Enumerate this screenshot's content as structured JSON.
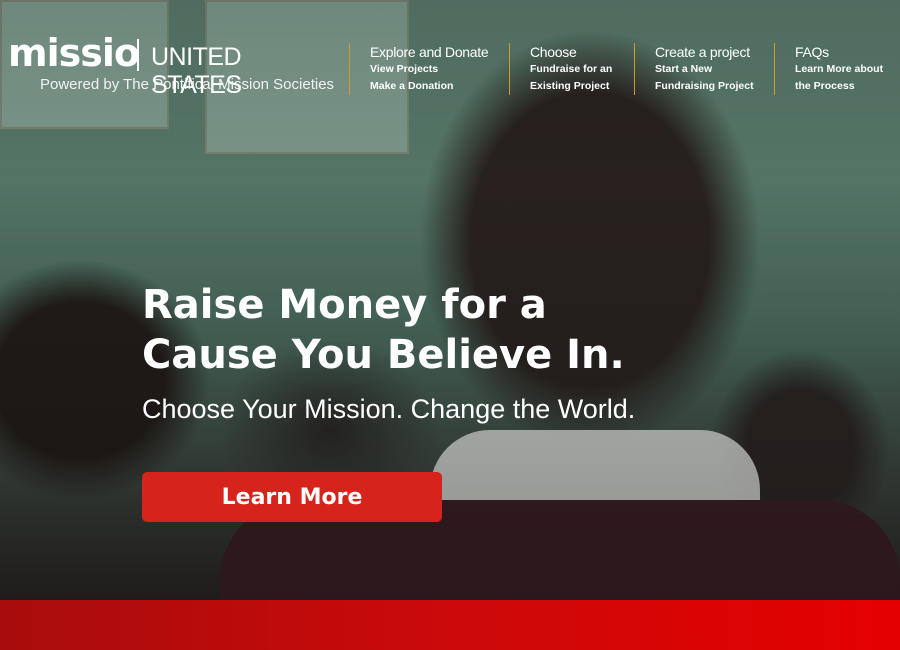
{
  "brand": {
    "logo_word": "missio",
    "country": "UNITED STATES",
    "tagline": "Powered by The Pontifical Mission Societies"
  },
  "nav": [
    {
      "title": "Explore and Donate",
      "sub": [
        "View Projects",
        "Make a Donation"
      ]
    },
    {
      "title": "Choose",
      "sub": [
        "Fundraise for an",
        "Existing Project"
      ]
    },
    {
      "title": "Create a project",
      "sub": [
        "Start a New",
        "Fundraising Project"
      ]
    },
    {
      "title": "FAQs",
      "sub": [
        "Learn More about",
        "the Process"
      ]
    }
  ],
  "hero": {
    "title_line1": "Raise Money for a",
    "title_line2": "Cause You Believe In.",
    "subtitle": "Choose Your Mission. Change the World.",
    "cta_label": "Learn More"
  },
  "colors": {
    "accent": "#d6231c",
    "nav_divider": "#d39a2a",
    "footer_band": "#cc0a0a"
  }
}
